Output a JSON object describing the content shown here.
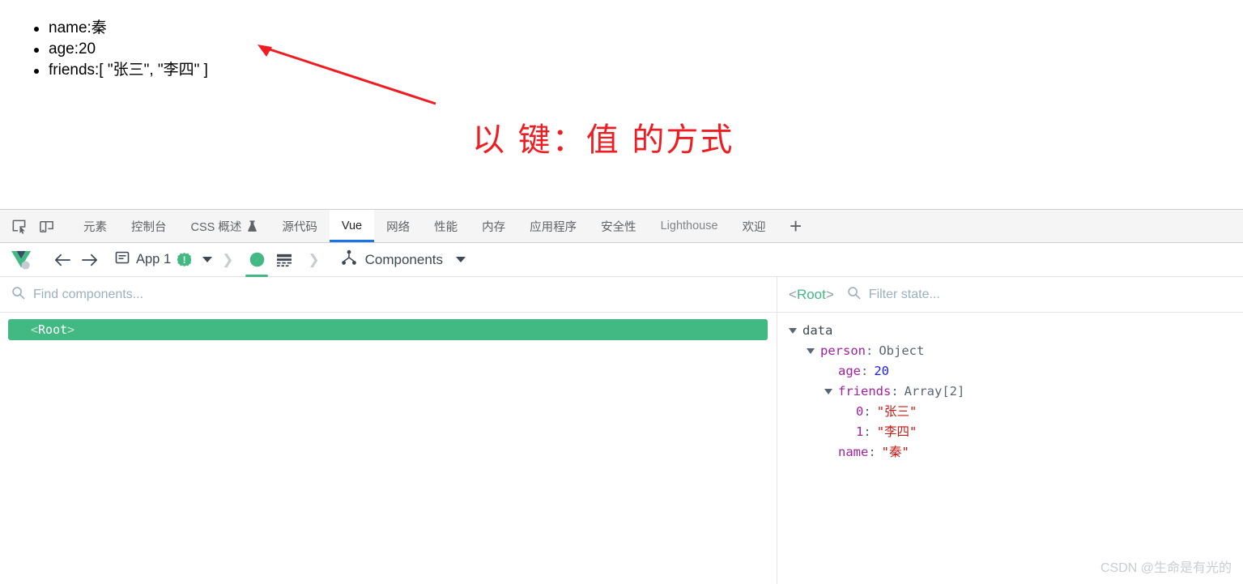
{
  "app_output": {
    "items": [
      "name:秦",
      "age:20",
      "friends:[ \"张三\", \"李四\" ]"
    ]
  },
  "annotation": {
    "text": "以 键：值 的方式",
    "color": "#ef1c21"
  },
  "devtools": {
    "tabs": [
      {
        "label": "元素",
        "active": false,
        "dim": false
      },
      {
        "label": "控制台",
        "active": false,
        "dim": false
      },
      {
        "label": "CSS 概述",
        "active": false,
        "dim": false,
        "flask": true
      },
      {
        "label": "源代码",
        "active": false,
        "dim": false
      },
      {
        "label": "Vue",
        "active": true,
        "dim": false
      },
      {
        "label": "网络",
        "active": false,
        "dim": false
      },
      {
        "label": "性能",
        "active": false,
        "dim": false
      },
      {
        "label": "内存",
        "active": false,
        "dim": false
      },
      {
        "label": "应用程序",
        "active": false,
        "dim": false
      },
      {
        "label": "安全性",
        "active": false,
        "dim": false
      },
      {
        "label": "Lighthouse",
        "active": false,
        "dim": true
      },
      {
        "label": "欢迎",
        "active": false,
        "dim": false
      }
    ],
    "add_tab_label": "+",
    "accent_active": "#1a73e8"
  },
  "vue_toolbar": {
    "app_label": "App 1",
    "app_badge": "!",
    "view_label": "Components",
    "accent": "#42b883"
  },
  "components_pane": {
    "search_placeholder": "Find components...",
    "tree": [
      {
        "label": "<Root>",
        "open_angle": "<",
        "name": "Root",
        "close_angle": ">",
        "selected": true
      }
    ]
  },
  "state_pane": {
    "breadcrumb_open": "<",
    "breadcrumb_name": "Root",
    "breadcrumb_close": ">",
    "filter_placeholder": "Filter state...",
    "rows": [
      {
        "indent": 0,
        "arrow": "down",
        "key": "data",
        "key_style": "root",
        "sep": "",
        "value": "",
        "value_style": ""
      },
      {
        "indent": 1,
        "arrow": "down",
        "key": "person",
        "key_style": "prop",
        "sep": ":",
        "value": "Object",
        "value_style": "type"
      },
      {
        "indent": 2,
        "arrow": "none",
        "key": "age",
        "key_style": "prop",
        "sep": ":",
        "value": "20",
        "value_style": "num"
      },
      {
        "indent": 2,
        "arrow": "down",
        "key": "friends",
        "key_style": "prop",
        "sep": ":",
        "value": "Array[2]",
        "value_style": "type"
      },
      {
        "indent": 3,
        "arrow": "none",
        "key": "0",
        "key_style": "prop",
        "sep": ":",
        "value": "\"张三\"",
        "value_style": "str"
      },
      {
        "indent": 3,
        "arrow": "none",
        "key": "1",
        "key_style": "prop",
        "sep": ":",
        "value": "\"李四\"",
        "value_style": "str"
      },
      {
        "indent": 2,
        "arrow": "none",
        "key": "name",
        "key_style": "prop",
        "sep": ":",
        "value": "\"秦\"",
        "value_style": "str"
      }
    ]
  },
  "watermark": "CSDN @生命是有光的"
}
